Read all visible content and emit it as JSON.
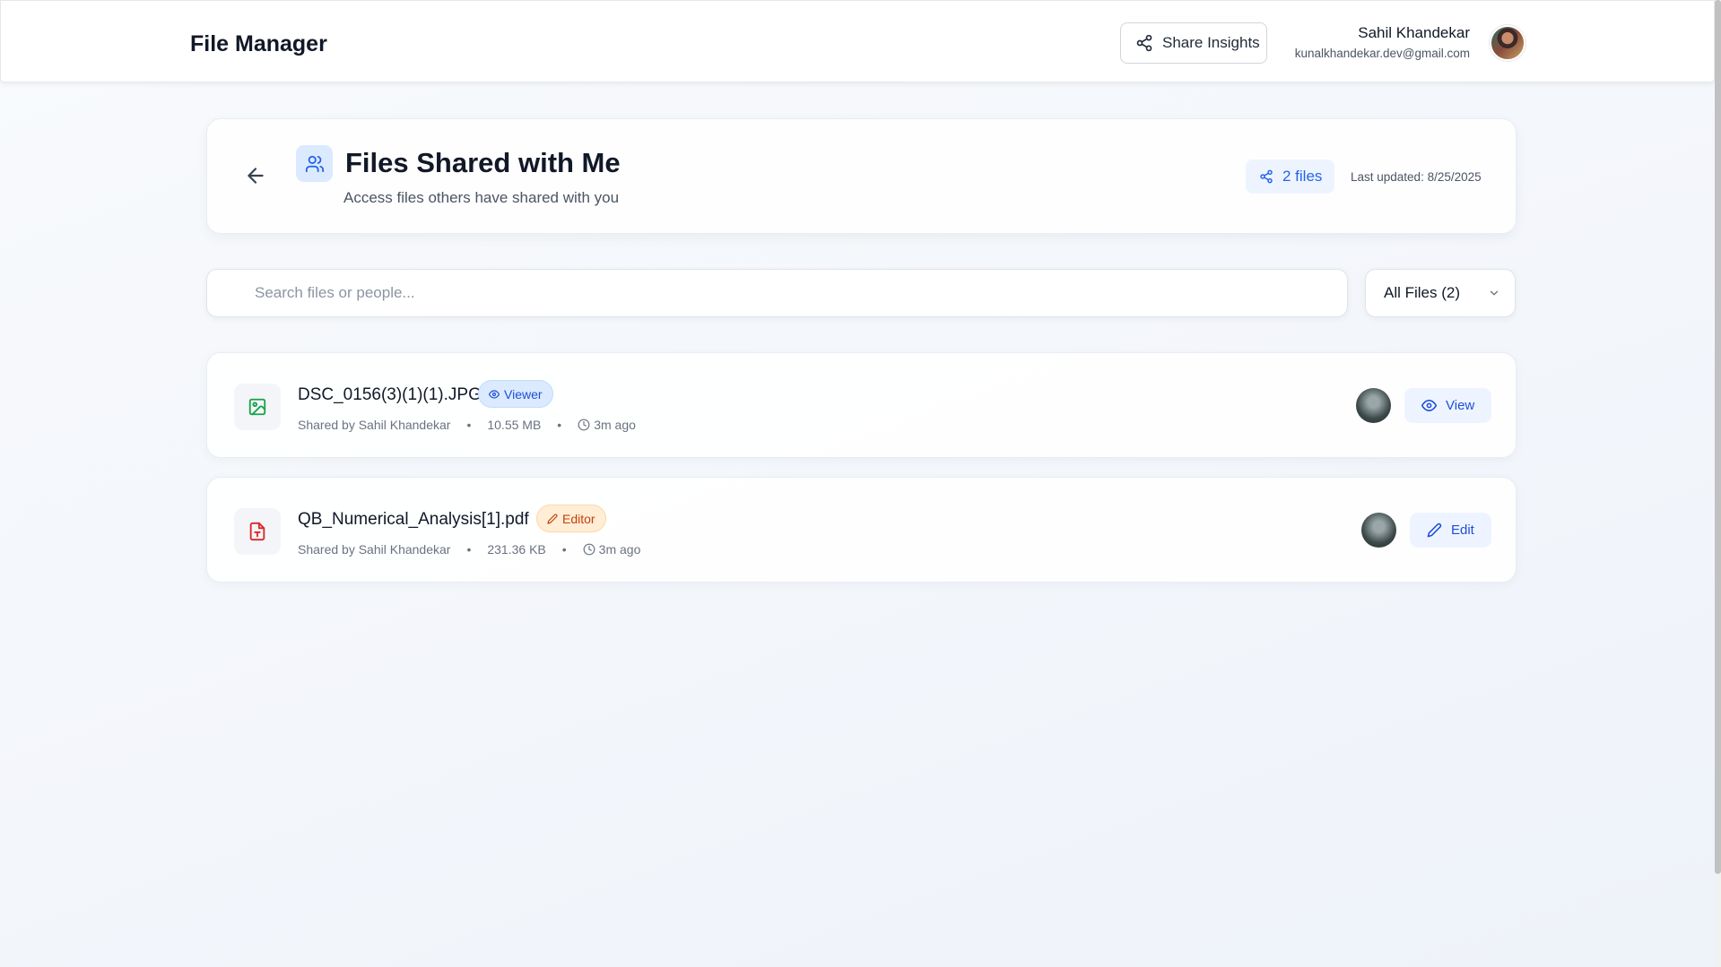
{
  "header": {
    "app_title": "File Manager",
    "share_insights_label": "Share Insights",
    "user_name": "Sahil Khandekar",
    "user_email": "kunalkhandekar.dev@gmail.com"
  },
  "page": {
    "title": "Files Shared with Me",
    "subtitle": "Access files others have shared with you",
    "files_count_label": "2 files",
    "last_updated": "Last updated: 8/25/2025"
  },
  "search": {
    "placeholder": "Search files or people...",
    "value": ""
  },
  "filter": {
    "selected": "All Files (2)"
  },
  "files": [
    {
      "name": "DSC_0156(3)(1)(1).JPG",
      "type_icon": "image-file-icon",
      "role": "Viewer",
      "shared_by": "Shared by Sahil Khandekar",
      "size": "10.55 MB",
      "time": "3m ago",
      "action": "View",
      "icon_color": "#16a34a"
    },
    {
      "name": "QB_Numerical_Analysis[1].pdf",
      "type_icon": "pdf-file-icon",
      "role": "Editor",
      "shared_by": "Shared by Sahil Khandekar",
      "size": "231.36 KB",
      "time": "3m ago",
      "action": "Edit",
      "icon_color": "#dc2626"
    }
  ],
  "colors": {
    "accent": "#2563eb",
    "viewer_badge_bg": "#dbeafe",
    "editor_badge_bg": "#ffedd5"
  }
}
